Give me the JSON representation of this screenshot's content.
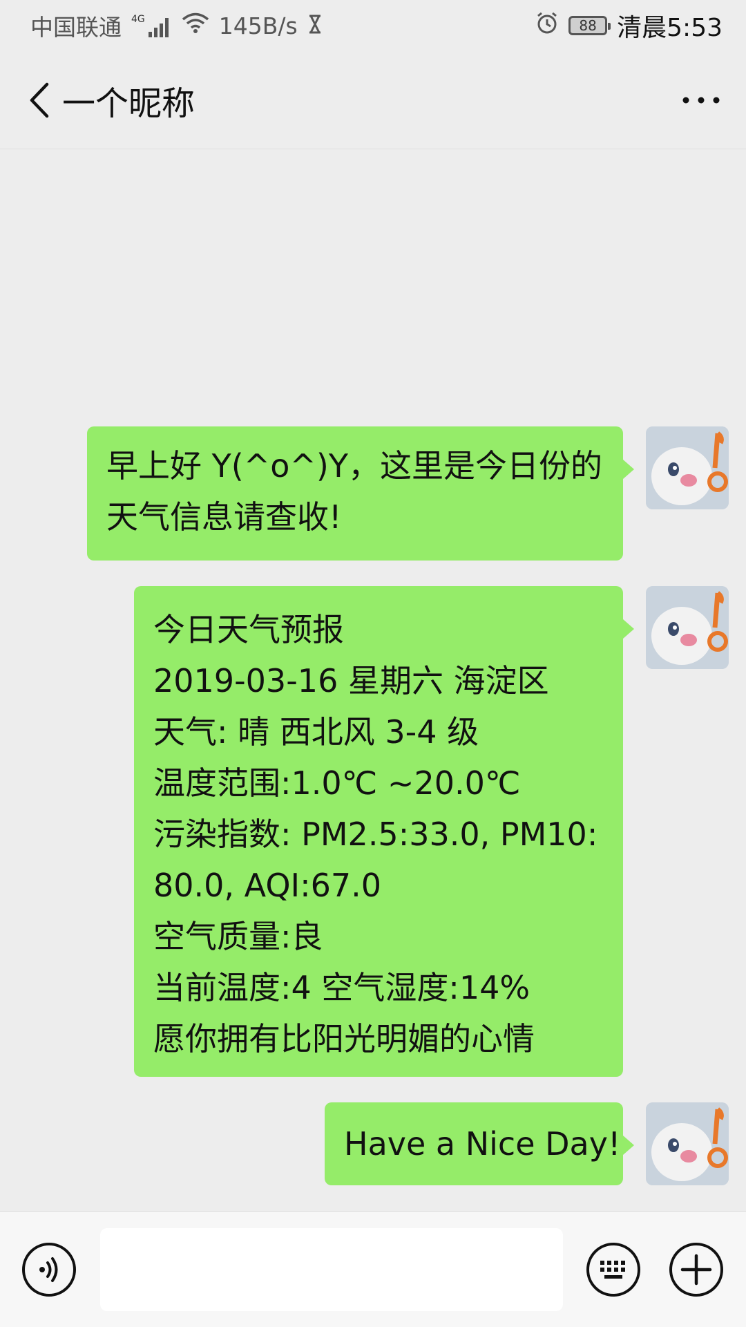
{
  "status_bar": {
    "carrier": "中国联通",
    "network": "4G",
    "speed": "145B/s",
    "battery": "88",
    "time": "清晨5:53"
  },
  "header": {
    "title": "一个昵称",
    "back_icon": "chevron-left-icon",
    "more_icon": "more-icon"
  },
  "messages": [
    {
      "lines": [
        "早上好 Y(^o^)Y，这里是今日份的",
        "天气信息请查收!"
      ]
    },
    {
      "lines": [
        "今日天气预报",
        "2019-03-16 星期六 海淀区",
        "天气: 晴  西北风 3-4 级",
        "温度范围:1.0℃ ~20.0℃",
        "污染指数: PM2.5:33.0, PM10:",
        "80.0, AQI:67.0",
        "空气质量:良",
        "当前温度:4    空气湿度:14%",
        "愿你拥有比阳光明媚的心情"
      ]
    },
    {
      "lines": [
        "Have a Nice Day!"
      ]
    }
  ],
  "input_bar": {
    "voice_icon": "voice-icon",
    "keyboard_icon": "keyboard-icon",
    "plus_icon": "plus-icon",
    "input_value": ""
  },
  "colors": {
    "bubble": "#95ec69",
    "background": "#ededed"
  }
}
